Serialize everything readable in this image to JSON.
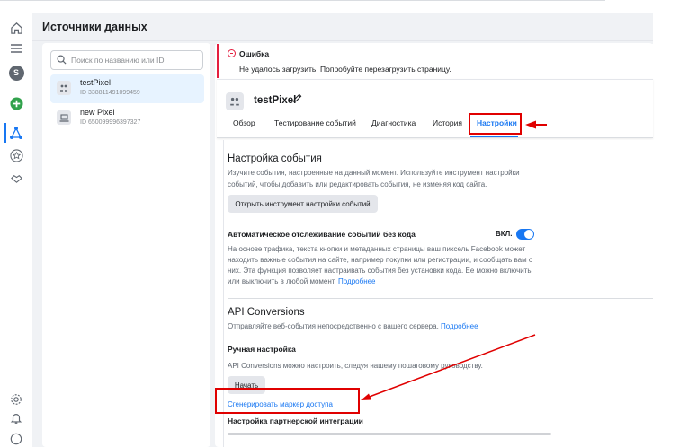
{
  "header": {
    "title": "Источники данных"
  },
  "search": {
    "placeholder": "Поиск по названию или ID"
  },
  "sources": [
    {
      "name": "testPixel",
      "id": "ID 338811491099459"
    },
    {
      "name": "new Pixel",
      "id": "ID 650099996397327"
    }
  ],
  "error": {
    "title": "Ошибка",
    "text": "Не удалось загрузить. Попробуйте перезагрузить страницу."
  },
  "pixel": {
    "name": "testPixel"
  },
  "tabs": [
    "Обзор",
    "Тестирование событий",
    "Диагностика",
    "История",
    "Настройки"
  ],
  "event_setup": {
    "title": "Настройка события",
    "desc1": "Изучите события, настроенные на данный момент. Используйте инструмент настройки",
    "desc2": "событий, чтобы добавить или редактировать события, не изменяя код сайта.",
    "button": "Открыть инструмент настройки событий"
  },
  "auto_tracking": {
    "title": "Автоматическое отслеживание событий без кода",
    "state": "ВКЛ.",
    "line1": "На основе трафика, текста кнопки и метаданных страницы ваш пиксель Facebook может",
    "line2": "находить важные события на сайте, например покупки или регистрации, и сообщать вам о",
    "line3": "них. Эта функция позволяет настраивать события без установки кода. Ее можно включить",
    "line4": "или выключить в любой момент.",
    "more": "Подробнее"
  },
  "api": {
    "title": "API Conversions",
    "desc": "Отправляйте веб-события непосредственно с вашего сервера.",
    "more": "Подробнее",
    "manual_title": "Ручная настройка",
    "manual_desc": "API Conversions можно настроить, следуя нашему пошаговому руководству.",
    "start": "Начать",
    "token": "Сгенерировать маркер доступа",
    "partner_title": "Настройка партнерской интеграции"
  },
  "colors": {
    "accent": "#1877f2",
    "error": "#e41e3f",
    "annotation": "#e00000"
  }
}
